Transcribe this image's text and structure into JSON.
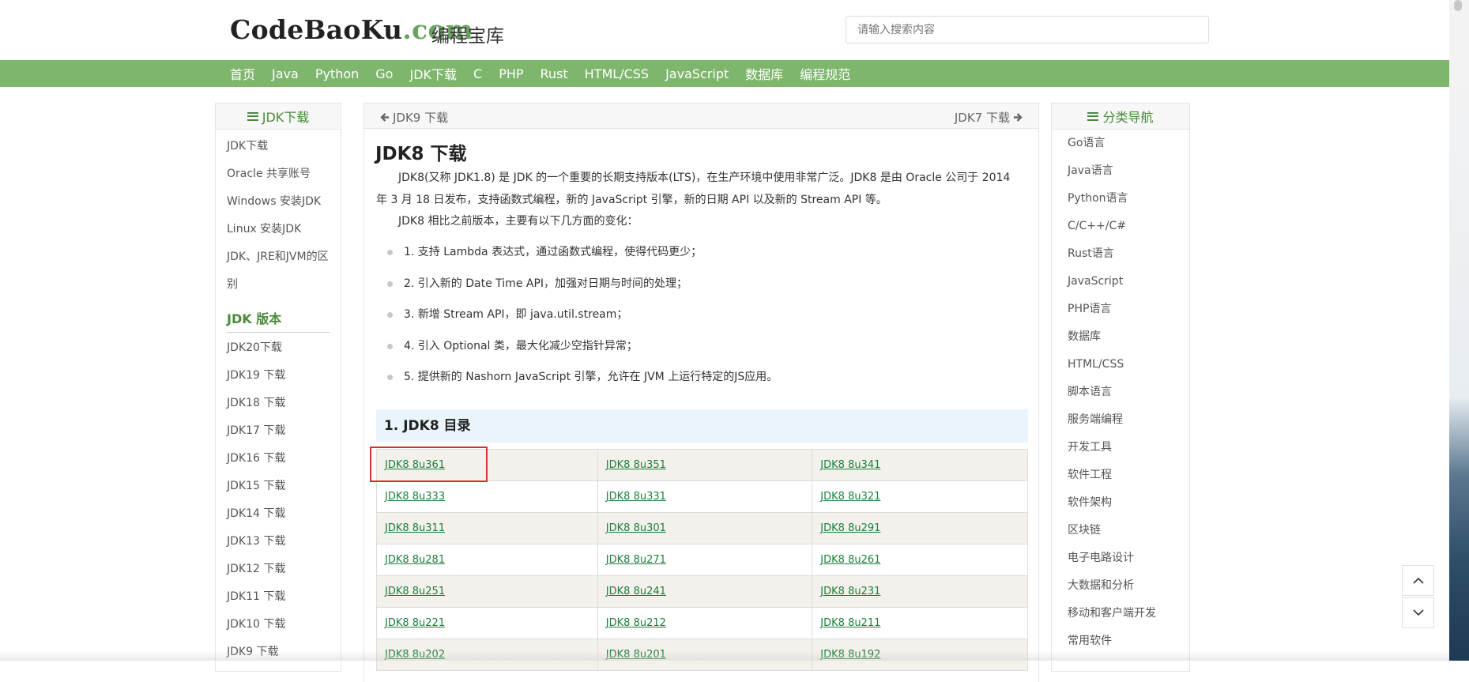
{
  "header": {
    "logo_main": "CodeBaoKu",
    "logo_dot": ".com",
    "logo_cn": "编程宝库",
    "search_placeholder": "请输入搜索内容"
  },
  "nav": [
    "首页",
    "Java",
    "Python",
    "Go",
    "JDK下载",
    "C",
    "PHP",
    "Rust",
    "HTML/CSS",
    "JavaScript",
    "数据库",
    "编程规范"
  ],
  "left_sidebar": {
    "title": "JDK下载",
    "links": [
      "JDK下载",
      "Oracle 共享账号",
      "Windows 安装JDK",
      "Linux 安装JDK",
      "JDK、JRE和JVM的区",
      "别"
    ],
    "section_title": "JDK 版本",
    "versions": [
      "JDK20下载",
      "JDK19 下载",
      "JDK18 下载",
      "JDK17 下载",
      "JDK16 下载",
      "JDK15 下载",
      "JDK14 下载",
      "JDK13 下载",
      "JDK12 下载",
      "JDK11 下载",
      "JDK10 下载",
      "JDK9 下载"
    ]
  },
  "main": {
    "prev": "JDK9 下载",
    "next": "JDK7 下载",
    "title": "JDK8 下载",
    "intro": "JDK8(又称 JDK1.8) 是 JDK 的一个重要的长期支持版本(LTS)，在生产环境中使用非常广泛。JDK8 是由 Oracle 公司于 2014 年 3 月 18 日发布，支持函数式编程，新的 JavaScript 引擎，新的日期 API 以及新的 Stream API 等。",
    "intro2": "JDK8 相比之前版本，主要有以下几方面的变化：",
    "features": [
      "1. 支持 Lambda 表达式，通过函数式编程，使得代码更少；",
      "2. 引入新的 Date Time API，加强对日期与时间的处理；",
      "3. 新增 Stream API，即 java.util.stream；",
      "4. 引入 Optional 类，最大化减少空指针异常；",
      "5. 提供新的 Nashorn JavaScript 引擎，允许在 JVM 上运行特定的JS应用。"
    ],
    "toc_title": "1. JDK8 目录",
    "table": [
      [
        "JDK8 8u361",
        "JDK8 8u351",
        "JDK8 8u341"
      ],
      [
        "JDK8 8u333",
        "JDK8 8u331",
        "JDK8 8u321"
      ],
      [
        "JDK8 8u311",
        "JDK8 8u301",
        "JDK8 8u291"
      ],
      [
        "JDK8 8u281",
        "JDK8 8u271",
        "JDK8 8u261"
      ],
      [
        "JDK8 8u251",
        "JDK8 8u241",
        "JDK8 8u231"
      ],
      [
        "JDK8 8u221",
        "JDK8 8u212",
        "JDK8 8u211"
      ],
      [
        "JDK8 8u202",
        "JDK8 8u201",
        "JDK8 8u192"
      ]
    ]
  },
  "right_sidebar": {
    "title": "分类导航",
    "links": [
      "Go语言",
      "Java语言",
      "Python语言",
      "C/C++/C#",
      "Rust语言",
      "JavaScript",
      "PHP语言",
      "数据库",
      "HTML/CSS",
      "脚本语言",
      "服务端编程",
      "开发工具",
      "软件工程",
      "软件架构",
      "区块链",
      "电子电路设计",
      "大数据和分析",
      "移动和客户端开发",
      "常用软件"
    ]
  }
}
